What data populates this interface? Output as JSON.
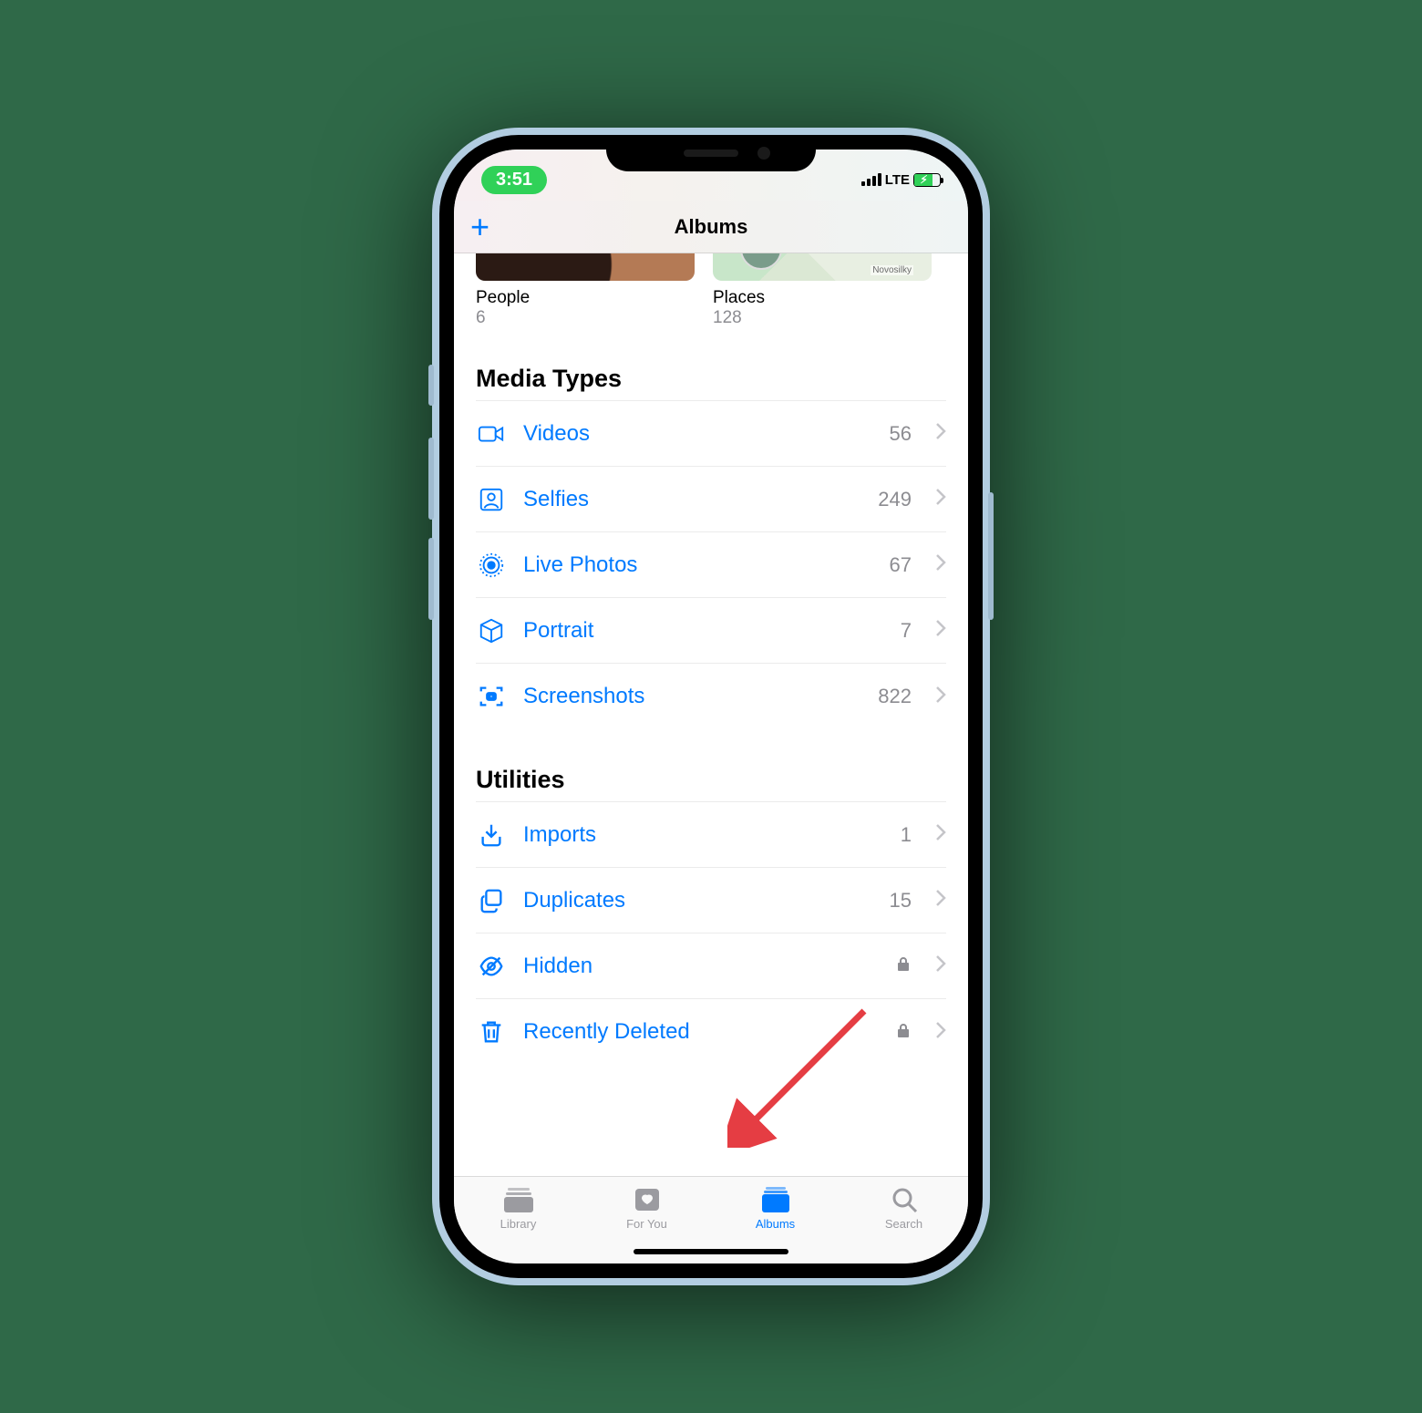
{
  "status": {
    "time": "3:51",
    "network": "LTE"
  },
  "nav": {
    "title": "Albums",
    "add_aria": "Add"
  },
  "collections": {
    "people": {
      "label": "People",
      "count": "6"
    },
    "places": {
      "label": "Places",
      "count": "128",
      "map_label": "Novosilky"
    }
  },
  "sections": {
    "media": {
      "header": "Media Types",
      "rows": [
        {
          "icon": "video",
          "label": "Videos",
          "count": "56"
        },
        {
          "icon": "selfie",
          "label": "Selfies",
          "count": "249"
        },
        {
          "icon": "live",
          "label": "Live Photos",
          "count": "67"
        },
        {
          "icon": "cube",
          "label": "Portrait",
          "count": "7"
        },
        {
          "icon": "screenshot",
          "label": "Screenshots",
          "count": "822"
        }
      ]
    },
    "utilities": {
      "header": "Utilities",
      "rows": [
        {
          "icon": "import",
          "label": "Imports",
          "count": "1"
        },
        {
          "icon": "duplicate",
          "label": "Duplicates",
          "count": "15"
        },
        {
          "icon": "hidden",
          "label": "Hidden",
          "locked": true
        },
        {
          "icon": "trash",
          "label": "Recently Deleted",
          "locked": true
        }
      ]
    }
  },
  "tabs": {
    "library": "Library",
    "for_you": "For You",
    "albums": "Albums",
    "search": "Search",
    "active": "albums"
  }
}
